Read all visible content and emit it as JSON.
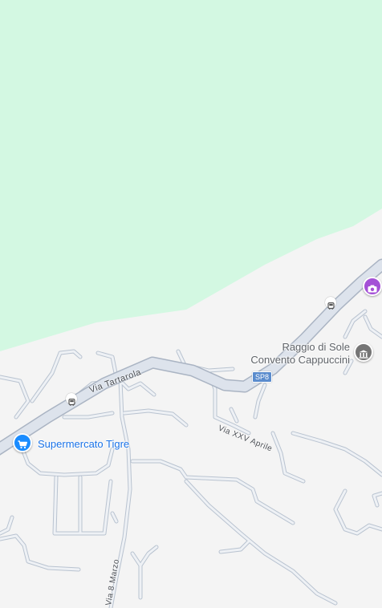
{
  "colors": {
    "park": "#d3f8e2",
    "land": "#f4f4f4",
    "road_fill": "#dde3ec",
    "road_stroke": "#aab4c3",
    "street_label": "#4b4f55",
    "shopping": "#1a8cff",
    "museum": "#757575",
    "attraction": "#a450d6",
    "route_shield": "#5b8ccd"
  },
  "pois": {
    "supermarket": {
      "label": "Supermercato Tigre",
      "icon": "shopping-cart-icon"
    },
    "convent": {
      "label_line1": "Raggio di Sole",
      "label_line2": "Convento Cappuccini",
      "icon": "museum-icon"
    },
    "viewpoint": {
      "icon": "camera-icon"
    }
  },
  "streets": {
    "via_tartarola": "Via Tartarola",
    "via_xxv_aprile": "Via XXV Aprile",
    "via_8_marzo": "Via 8 Marzo"
  },
  "route_shield": {
    "label": "SP8"
  },
  "transit": {
    "bus_stop_icon": "bus-icon"
  }
}
